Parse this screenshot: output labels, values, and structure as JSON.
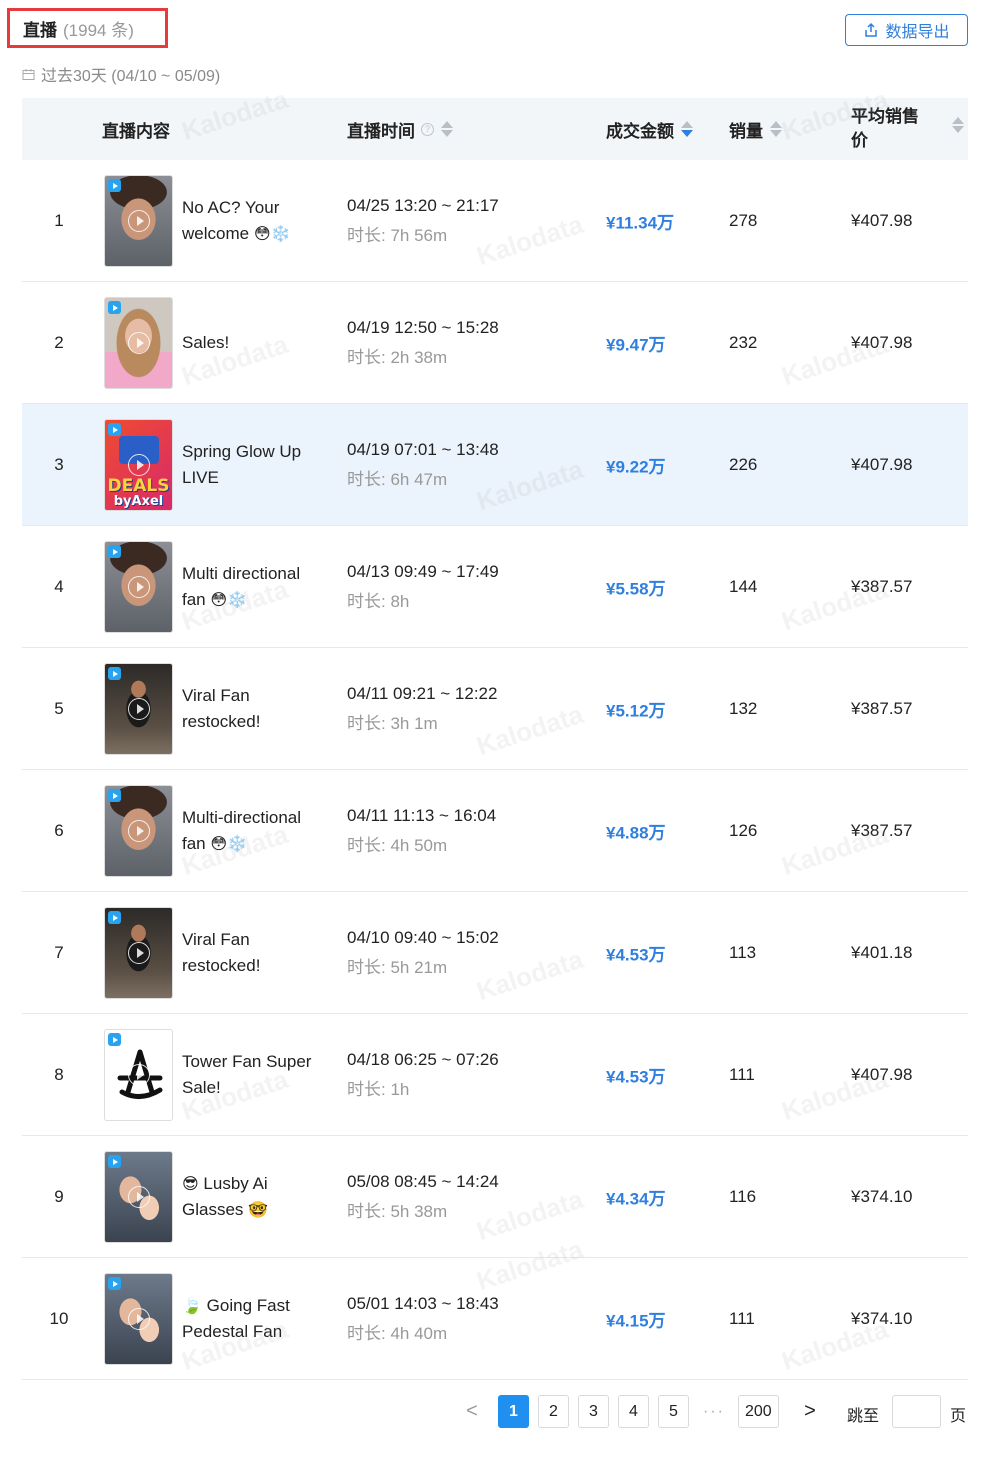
{
  "header": {
    "title": "直播",
    "count": "(1994 条)",
    "export_label": "数据导出",
    "date_range": "过去30天 (04/10 ~ 05/09)"
  },
  "columns": {
    "content": "直播内容",
    "time": "直播时间",
    "amount": "成交金额",
    "sales": "销量",
    "avg_line1": "平均销售",
    "avg_line2": "价"
  },
  "rows": [
    {
      "rank": "1",
      "thumb": "man",
      "name_text": "No AC? Your welcome",
      "emoji": "😳❄️",
      "emoji_pre": "",
      "range": "04/25 13:20 ~ 21:17",
      "duration": "时长: 7h 56m",
      "amount": "¥11.34万",
      "sales": "278",
      "avg": "¥407.98"
    },
    {
      "rank": "2",
      "thumb": "woman",
      "name_text": "Sales!",
      "emoji": "",
      "emoji_pre": "",
      "range": "04/19 12:50 ~ 15:28",
      "duration": "时长: 2h 38m",
      "amount": "¥9.47万",
      "sales": "232",
      "avg": "¥407.98"
    },
    {
      "rank": "3",
      "thumb": "deals",
      "name_text": "Spring Glow Up LIVE",
      "emoji": "",
      "emoji_pre": "",
      "range": "04/19 07:01 ~ 13:48",
      "duration": "时长: 6h 47m",
      "amount": "¥9.22万",
      "sales": "226",
      "avg": "¥407.98"
    },
    {
      "rank": "4",
      "thumb": "man",
      "name_text": "Multi directional fan",
      "emoji": "😳❄️",
      "emoji_pre": "",
      "range": "04/13 09:49 ~ 17:49",
      "duration": "时长: 8h",
      "amount": "¥5.58万",
      "sales": "144",
      "avg": "¥387.57"
    },
    {
      "rank": "5",
      "thumb": "viral",
      "name_text": "Viral Fan restocked!",
      "emoji": "",
      "emoji_pre": "",
      "range": "04/11 09:21 ~ 12:22",
      "duration": "时长: 3h 1m",
      "amount": "¥5.12万",
      "sales": "132",
      "avg": "¥387.57"
    },
    {
      "rank": "6",
      "thumb": "man",
      "name_text": "Multi-directional fan",
      "emoji": "😳❄️",
      "emoji_pre": "",
      "range": "04/11 11:13 ~ 16:04",
      "duration": "时长: 4h 50m",
      "amount": "¥4.88万",
      "sales": "126",
      "avg": "¥387.57"
    },
    {
      "rank": "7",
      "thumb": "viral",
      "name_text": "Viral Fan restocked!",
      "emoji": "",
      "emoji_pre": "",
      "range": "04/10 09:40 ~ 15:02",
      "duration": "时长: 5h 21m",
      "amount": "¥4.53万",
      "sales": "113",
      "avg": "¥401.18"
    },
    {
      "rank": "8",
      "thumb": "logo",
      "name_text": "Tower Fan Super Sale!",
      "emoji": "",
      "emoji_pre": "",
      "range": "04/18 06:25 ~ 07:26",
      "duration": "时长: 1h",
      "amount": "¥4.53万",
      "sales": "111",
      "avg": "¥407.98"
    },
    {
      "rank": "9",
      "thumb": "family",
      "name_text": "Lusby Ai Glasses",
      "emoji": "🤓",
      "emoji_pre": "😎",
      "range": "05/08 08:45 ~ 14:24",
      "duration": "时长: 5h 38m",
      "amount": "¥4.34万",
      "sales": "116",
      "avg": "¥374.10"
    },
    {
      "rank": "10",
      "thumb": "family",
      "name_text": "Going Fast Pedestal Fan",
      "emoji": "",
      "emoji_pre": "🍃",
      "range": "05/01 14:03 ~ 18:43",
      "duration": "时长: 4h 40m",
      "amount": "¥4.15万",
      "sales": "111",
      "avg": "¥374.10"
    }
  ],
  "deals_thumb": {
    "line1": "DEALS",
    "line2": "byAxel"
  },
  "pagination": {
    "pages": [
      "1",
      "2",
      "3",
      "4",
      "5"
    ],
    "ellipsis": "···",
    "last": "200",
    "prev": "<",
    "next": ">",
    "jump_label": "跳至",
    "page_suffix": "页"
  },
  "watermark": "Kalodata",
  "colors": {
    "accent": "#2f7fde",
    "highlight_row": "#ebf3fc",
    "title_border": "#e8393b"
  }
}
